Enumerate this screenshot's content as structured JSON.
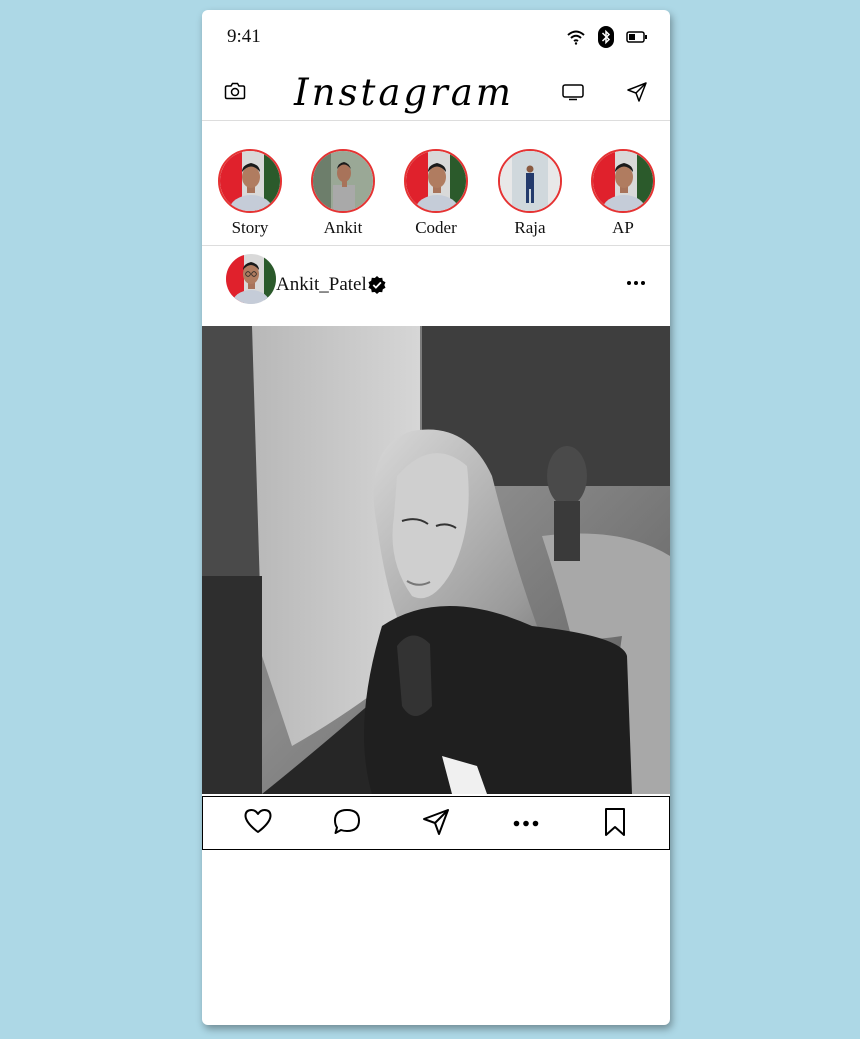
{
  "status_bar": {
    "time": "9:41",
    "icons": [
      "wifi-icon",
      "bluetooth-icon",
      "battery-icon"
    ]
  },
  "topbar": {
    "brand": "Instagram",
    "icons": [
      "camera-icon",
      "igtv-icon",
      "direct-message-icon"
    ]
  },
  "stories": [
    {
      "name": "Story"
    },
    {
      "name": "Ankit"
    },
    {
      "name": "Coder"
    },
    {
      "name": "Raja"
    },
    {
      "name": "AP"
    }
  ],
  "post": {
    "username": "Ankit_Patel",
    "verified": true,
    "actions": [
      "like-icon",
      "comment-icon",
      "share-icon",
      "more-icon",
      "bookmark-icon"
    ]
  },
  "colors": {
    "background": "#add8e6",
    "story_ring": "#e53333"
  }
}
